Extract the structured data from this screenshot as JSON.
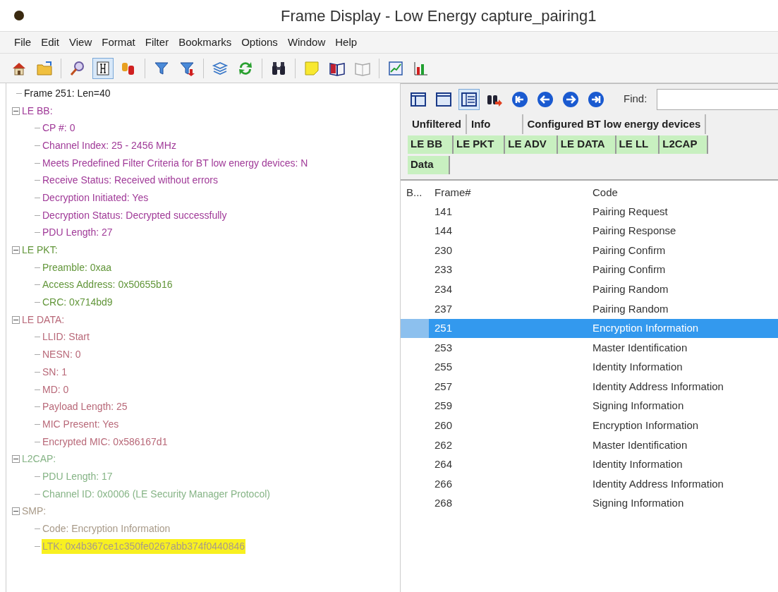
{
  "window": {
    "title": "Frame Display - Low Energy capture_pairing1"
  },
  "menu": [
    "File",
    "Edit",
    "View",
    "Format",
    "Filter",
    "Bookmarks",
    "Options",
    "Window",
    "Help"
  ],
  "toolbar": [
    {
      "kind": "home",
      "pressed": false
    },
    {
      "kind": "folder",
      "pressed": false
    },
    {
      "kind": "sep"
    },
    {
      "kind": "magnifier",
      "pressed": false
    },
    {
      "kind": "hex",
      "pressed": true
    },
    {
      "kind": "cylinders",
      "pressed": false
    },
    {
      "kind": "sep"
    },
    {
      "kind": "funnel",
      "pressed": false
    },
    {
      "kind": "funnel-arrow",
      "pressed": false
    },
    {
      "kind": "sep"
    },
    {
      "kind": "layers",
      "pressed": false
    },
    {
      "kind": "refresh",
      "pressed": false
    },
    {
      "kind": "sep"
    },
    {
      "kind": "binoculars",
      "pressed": false
    },
    {
      "kind": "sep"
    },
    {
      "kind": "note",
      "pressed": false
    },
    {
      "kind": "book",
      "pressed": false
    },
    {
      "kind": "book-grey",
      "pressed": false
    },
    {
      "kind": "sep"
    },
    {
      "kind": "chart-line",
      "pressed": false
    },
    {
      "kind": "chart-bar",
      "pressed": false
    }
  ],
  "tree": [
    {
      "label": "Frame 251:  Len=40",
      "color": "#222222"
    },
    {
      "label": "LE BB:",
      "color": "#a03a98",
      "expanded": true,
      "children": [
        {
          "label": "CP #: 0"
        },
        {
          "label": "Channel Index: 25 - 2456 MHz"
        },
        {
          "label": "Meets Predefined Filter Criteria for BT low energy devices: N"
        },
        {
          "label": "Receive Status: Received without errors"
        },
        {
          "label": "Decryption Initiated: Yes"
        },
        {
          "label": "Decryption Status: Decrypted successfully"
        },
        {
          "label": "PDU Length: 27"
        }
      ]
    },
    {
      "label": "LE PKT:",
      "color": "#62963a",
      "expanded": true,
      "children": [
        {
          "label": "Preamble: 0xaa"
        },
        {
          "label": "Access Address: 0x50655b16"
        },
        {
          "label": "CRC: 0x714bd9"
        }
      ]
    },
    {
      "label": "LE DATA:",
      "color": "#b86878",
      "expanded": true,
      "children": [
        {
          "label": "LLID: Start"
        },
        {
          "label": "NESN: 0"
        },
        {
          "label": "SN: 1"
        },
        {
          "label": "MD: 0"
        },
        {
          "label": "Payload Length: 25"
        },
        {
          "label": "MIC Present: Yes"
        },
        {
          "label": "Encrypted MIC: 0x586167d1"
        }
      ]
    },
    {
      "label": "L2CAP:",
      "color": "#86b486",
      "expanded": true,
      "children": [
        {
          "label": "PDU Length: 17"
        },
        {
          "label": "Channel ID: 0x0006  (LE Security Manager Protocol)"
        }
      ]
    },
    {
      "label": "SMP:",
      "color": "#a89a88",
      "expanded": true,
      "children": [
        {
          "label": "Code: Encryption Information",
          "highlighted": false
        },
        {
          "label": "LTK: 0x4b367ce1c350fe0267abb374f0440846",
          "highlighted": true
        }
      ]
    }
  ],
  "right_toolbar": [
    {
      "kind": "pane-left",
      "pressed": false
    },
    {
      "kind": "pane-top",
      "pressed": false
    },
    {
      "kind": "pane-list",
      "pressed": true
    },
    {
      "kind": "binoculars-arrow",
      "pressed": false
    },
    {
      "kind": "first"
    },
    {
      "kind": "prev"
    },
    {
      "kind": "next"
    },
    {
      "kind": "last"
    }
  ],
  "find": {
    "label": "Find:"
  },
  "filter_tabs": [
    "Unfiltered",
    "Info",
    "Configured BT low energy devices"
  ],
  "protocol_tab_rows": [
    [
      "LE BB",
      "LE PKT",
      "LE ADV",
      "LE DATA",
      "LE LL",
      "L2CAP"
    ],
    [
      "Data"
    ]
  ],
  "table": {
    "columns": [
      "B...",
      "Frame#",
      "Code"
    ],
    "rows": [
      {
        "frame": "141",
        "code": "Pairing Request",
        "selected": false
      },
      {
        "frame": "144",
        "code": "Pairing Response",
        "selected": false
      },
      {
        "frame": "230",
        "code": "Pairing Confirm",
        "selected": false
      },
      {
        "frame": "233",
        "code": "Pairing Confirm",
        "selected": false
      },
      {
        "frame": "234",
        "code": "Pairing Random",
        "selected": false
      },
      {
        "frame": "237",
        "code": "Pairing Random",
        "selected": false
      },
      {
        "frame": "251",
        "code": "Encryption Information",
        "selected": true
      },
      {
        "frame": "253",
        "code": "Master Identification",
        "selected": false
      },
      {
        "frame": "255",
        "code": "Identity Information",
        "selected": false
      },
      {
        "frame": "257",
        "code": "Identity Address Information",
        "selected": false
      },
      {
        "frame": "259",
        "code": "Signing Information",
        "selected": false
      },
      {
        "frame": "260",
        "code": "Encryption Information",
        "selected": false
      },
      {
        "frame": "262",
        "code": "Master Identification",
        "selected": false
      },
      {
        "frame": "264",
        "code": "Identity Information",
        "selected": false
      },
      {
        "frame": "266",
        "code": "Identity Address Information",
        "selected": false
      },
      {
        "frame": "268",
        "code": "Signing Information",
        "selected": false
      }
    ]
  }
}
